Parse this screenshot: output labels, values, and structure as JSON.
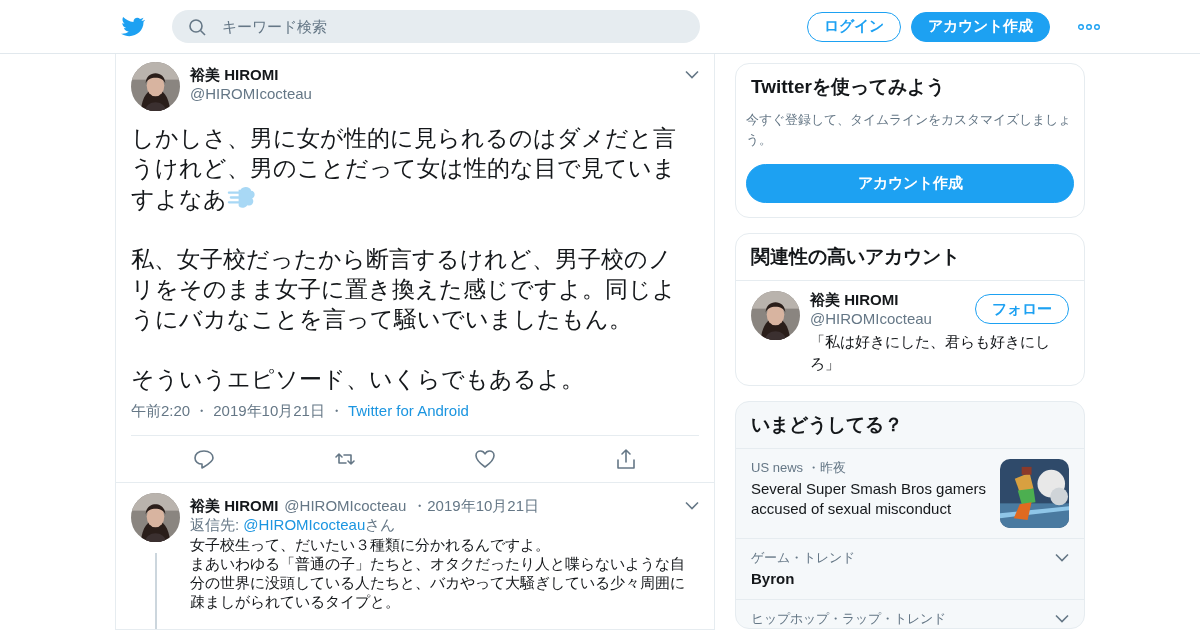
{
  "header": {
    "search": {
      "placeholder": "キーワード検索"
    },
    "buttons": [
      {
        "label": "ログイン",
        "kind": "outline"
      },
      {
        "label": "アカウント作成",
        "kind": "filled"
      }
    ]
  },
  "tweet": {
    "name": "裕美 HIROMI",
    "handle": "@HIROMIcocteau",
    "paragraphs": [
      {
        "kind": "with_dash",
        "text": "しかしさ、男に女が性的に見られるのはダメだと言うけれど、男のことだって女は性的な目で見ていますよなあ"
      },
      {
        "kind": "plain",
        "text": "私、女子校だったから断言するけれど、男子校のノリをそのまま女子に置き換えた感じですよ。同じようにバカなことを言って騒いでいましたもん。"
      },
      {
        "kind": "plain",
        "text": "そういうエピソード、いくらでもあるよ。"
      }
    ],
    "meta": [
      {
        "kind": "time",
        "text": "午前2:20"
      },
      {
        "kind": "separator",
        "text": "・"
      },
      {
        "kind": "date",
        "text": "2019年10月21日"
      },
      {
        "kind": "separator",
        "text": "・"
      },
      {
        "kind": "source",
        "text": "Twitter for Android"
      }
    ]
  },
  "reply": {
    "name": "裕美 HIROMI",
    "handle": "@HIROMIcocteau",
    "date": "・2019年10月21日",
    "reply_label": "返信先:",
    "reply_to": "@HIROMIcocteau",
    "reply_suffix": "さん",
    "lines": [
      "女子校生って、だいたい３種類に分かれるんですよ。",
      "まあいわゆる「普通の子」たちと、オタクだったり人と喋らないような自分の世界に没頭している人たちと、バカやって大騒ぎしている少々周囲に疎ましがられているタイプと。"
    ]
  },
  "signup_card": {
    "title": "Twitterを使ってみよう",
    "text": "今すぐ登録して、タイムラインをカスタマイズしましょう。",
    "button": "アカウント作成"
  },
  "related_card": {
    "title": "関連性の高いアカウント",
    "accounts": [
      {
        "name": "裕美 HIROMI",
        "handle": "@HIROMIcocteau",
        "bio": "「私は好きにした、君らも好きにしろ」",
        "button": "フォロー"
      }
    ]
  },
  "trends": {
    "title": "いまどうしてる？",
    "items": [
      {
        "kind": "news",
        "context": "US news",
        "time": "・昨夜",
        "headline": "Several Super Smash Bros gamers accused of sexual misconduct"
      },
      {
        "kind": "trend",
        "context": "ゲーム・トレンド",
        "headline": "Byron"
      },
      {
        "kind": "trend",
        "context": "ヒップホップ・ラップ・トレンド"
      }
    ]
  }
}
